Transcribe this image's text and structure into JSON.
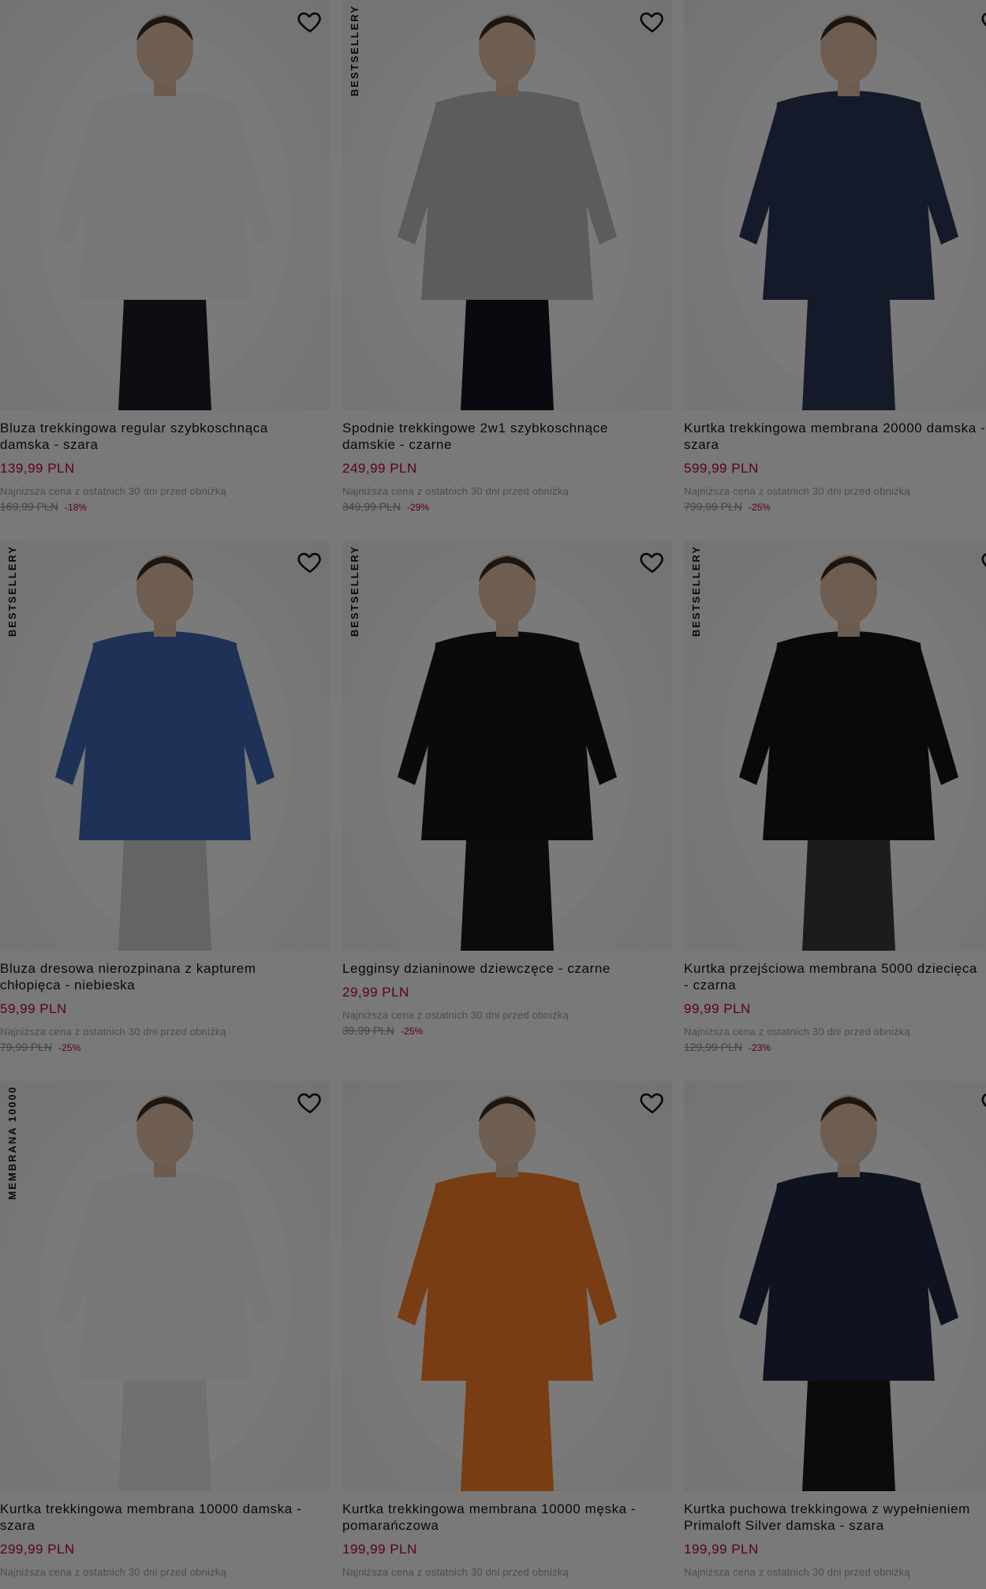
{
  "lowest_price_note": "Najniższa cena z ostatnich 30 dni przed obniżką",
  "products": [
    {
      "name": "Bluza trekkingowa regular szybkoschnąca\ndamska - szara",
      "price": "139,99 PLN",
      "old_price": "169,99 PLN",
      "discount": "-18%",
      "badge": "",
      "colors": {
        "top": "#eeeeee",
        "bottom": "#1c1c24"
      }
    },
    {
      "name": "Spodnie trekkingowe 2w1 szybkoschnące\ndamskie - czarne",
      "price": "249,99 PLN",
      "old_price": "349,99 PLN",
      "discount": "-29%",
      "badge": "BESTSELLERY",
      "colors": {
        "top": "#b9b9b9",
        "bottom": "#12141e"
      }
    },
    {
      "name": "Kurtka trekkingowa membrana 20000 damska -\nszara",
      "price": "599,99 PLN",
      "old_price": "799,99 PLN",
      "discount": "-25%",
      "badge": "",
      "colors": {
        "top": "#2b3454",
        "bottom": "#2b3454"
      }
    },
    {
      "name": "Bluza dresowa nierozpinana z kapturem\nchłopięca - niebieska",
      "price": "59,99 PLN",
      "old_price": "79,99 PLN",
      "discount": "-25%",
      "badge": "BESTSELLERY",
      "colors": {
        "top": "#3a64ad",
        "bottom": "#c9c9c9"
      }
    },
    {
      "name": "Legginsy dzianinowe dziewczęce - czarne",
      "price": "29,99 PLN",
      "old_price": "39,99 PLN",
      "discount": "-25%",
      "badge": "BESTSELLERY",
      "colors": {
        "top": "#141414",
        "bottom": "#161616"
      }
    },
    {
      "name": "Kurtka przejściowa membrana 5000 dziecięca\n- czarna",
      "price": "99,99 PLN",
      "old_price": "129,99 PLN",
      "discount": "-23%",
      "badge": "BESTSELLERY",
      "colors": {
        "top": "#131313",
        "bottom": "#3b3838"
      }
    },
    {
      "name": "Kurtka trekkingowa membrana 10000 damska -\nszara",
      "price": "299,99 PLN",
      "old_price": "",
      "discount": "",
      "badge": "MEMBRANA 10000",
      "colors": {
        "top": "#eeeeee",
        "bottom": "#e0e0e0"
      }
    },
    {
      "name": "Kurtka trekkingowa membrana 10000 męska -\npomarańczowa",
      "price": "199,99 PLN",
      "old_price": "",
      "discount": "",
      "badge": "",
      "colors": {
        "top": "#f07a25",
        "bottom": "#f07a25"
      }
    },
    {
      "name": "Kurtka puchowa trekkingowa z wypełnieniem\nPrimaloft Silver damska - szara",
      "price": "199,99 PLN",
      "old_price": "",
      "discount": "",
      "badge": "",
      "colors": {
        "top": "#1f2540",
        "bottom": "#161616"
      }
    }
  ]
}
